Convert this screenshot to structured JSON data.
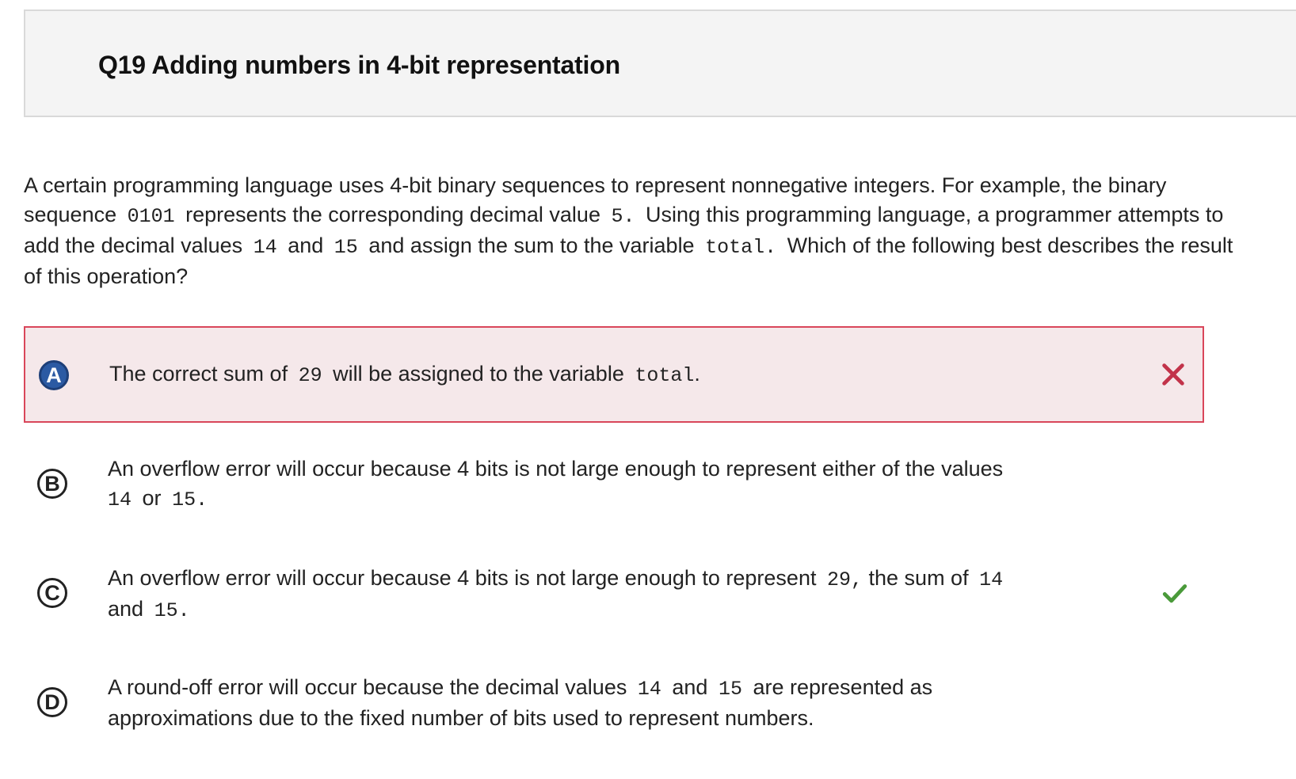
{
  "header": {
    "title": "Q19 Adding numbers in 4-bit representation"
  },
  "question": {
    "p1": "A certain programming language uses 4-bit binary sequences to represent nonnegative integers. For example, the binary sequence",
    "code1": "0101",
    "p2": "represents the corresponding decimal value",
    "code2": "5.",
    "p3": "Using this programming language, a programmer attempts to add the decimal values",
    "code3": "14",
    "p4": "and",
    "code4": "15",
    "p5": "and assign the sum to the variable",
    "code5": "total.",
    "p6": "Which of the following best describes the result of this operation?"
  },
  "options": [
    {
      "letter": "A",
      "t1": "The correct sum of",
      "c1": "29",
      "t2": "will be assigned to the variable",
      "c2": "total",
      "t3": ".",
      "status": "incorrect-selected"
    },
    {
      "letter": "B",
      "t1": "An overflow error will occur because 4 bits is not large enough to represent either of the values",
      "c1": "14",
      "t2": "or",
      "c2": "15.",
      "status": "none"
    },
    {
      "letter": "C",
      "t1": "An overflow error will occur because 4 bits is not large enough to represent",
      "c1": "29,",
      "t2": "the sum of",
      "c2": "14",
      "t3": "and",
      "c3": "15.",
      "status": "correct"
    },
    {
      "letter": "D",
      "t1": "A round-off error will occur because the decimal values",
      "c1": "14",
      "t2": "and",
      "c2": "15",
      "t3": "are represented as approximations due to the fixed number of bits used to represent numbers.",
      "status": "none"
    }
  ],
  "icons": {
    "incorrect": "close-icon",
    "correct": "check-icon"
  },
  "colors": {
    "incorrect_border": "#d9465a",
    "incorrect_bg": "#f5e8ea",
    "incorrect_mark": "#c2334a",
    "correct_mark": "#4a9a3a",
    "selected_letter": "#2b5aa3"
  }
}
